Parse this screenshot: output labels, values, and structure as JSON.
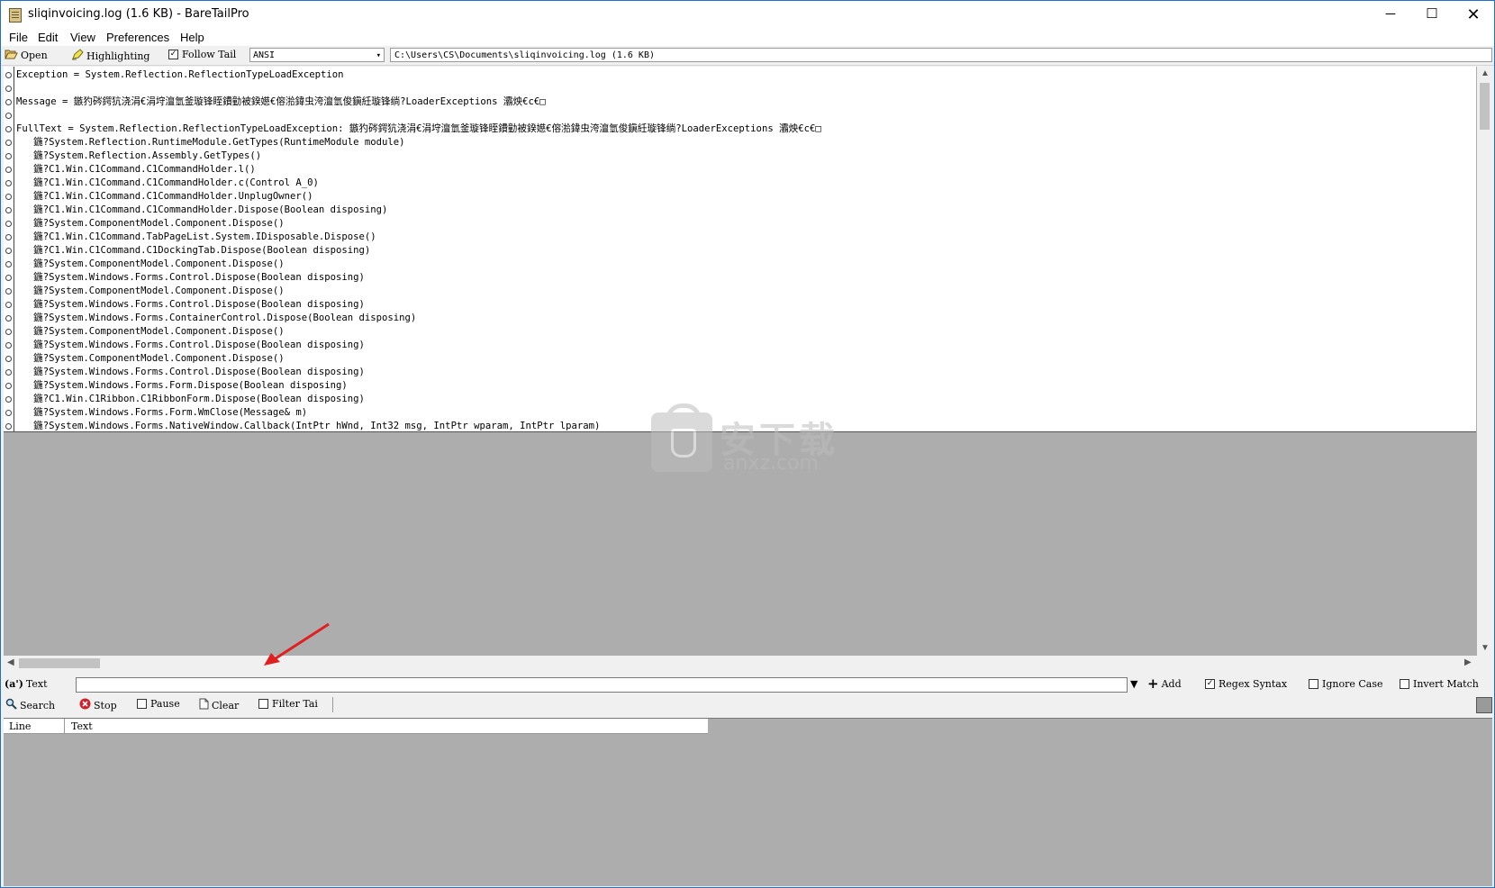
{
  "window": {
    "title": "sliqinvoicing.log (1.6 KB) - BareTailPro",
    "minimize": "─",
    "maximize": "☐",
    "close": "✕"
  },
  "menu": [
    "File",
    "Edit",
    "View",
    "Preferences",
    "Help"
  ],
  "toolbar": {
    "open_label": "Open",
    "highlighting_label": "Highlighting",
    "follow_tail_label": "Follow Tail",
    "follow_tail_checked": true,
    "encoding": "ANSI",
    "file_path": "C:\\Users\\CS\\Documents\\sliqinvoicing.log (1.6 KB)"
  },
  "log_lines": [
    "Exception = System.Reflection.ReflectionTypeLoadException",
    "",
    "Message = 鏃犳硶鍔犺浇涓€涓垨澶氫釜璇锋眰鐨勭被鍨嬨€傛湁鍏虫洿澶氫俊鎭紝璇锋绱?LoaderExceptions 灞炴€с€□",
    "",
    "FullText = System.Reflection.ReflectionTypeLoadException: 鏃犳硶鍔犺浇涓€涓垨澶氫釜璇锋眰鐨勭被鍨嬨€傛湁鍏虫洿澶氫俊鎭紝璇锋绱?LoaderExceptions 灞炴€с€□",
    "   鍦?System.Reflection.RuntimeModule.GetTypes(RuntimeModule module)",
    "   鍦?System.Reflection.Assembly.GetTypes()",
    "   鍦?C1.Win.C1Command.C1CommandHolder.l()",
    "   鍦?C1.Win.C1Command.C1CommandHolder.c(Control A_0)",
    "   鍦?C1.Win.C1Command.C1CommandHolder.UnplugOwner()",
    "   鍦?C1.Win.C1Command.C1CommandHolder.Dispose(Boolean disposing)",
    "   鍦?System.ComponentModel.Component.Dispose()",
    "   鍦?C1.Win.C1Command.TabPageList.System.IDisposable.Dispose()",
    "   鍦?C1.Win.C1Command.C1DockingTab.Dispose(Boolean disposing)",
    "   鍦?System.ComponentModel.Component.Dispose()",
    "   鍦?System.Windows.Forms.Control.Dispose(Boolean disposing)",
    "   鍦?System.ComponentModel.Component.Dispose()",
    "   鍦?System.Windows.Forms.Control.Dispose(Boolean disposing)",
    "   鍦?System.Windows.Forms.ContainerControl.Dispose(Boolean disposing)",
    "   鍦?System.ComponentModel.Component.Dispose()",
    "   鍦?System.Windows.Forms.Control.Dispose(Boolean disposing)",
    "   鍦?System.ComponentModel.Component.Dispose()",
    "   鍦?System.Windows.Forms.Control.Dispose(Boolean disposing)",
    "   鍦?System.Windows.Forms.Form.Dispose(Boolean disposing)",
    "   鍦?C1.Win.C1Ribbon.C1RibbonForm.Dispose(Boolean disposing)",
    "   鍦?System.Windows.Forms.Form.WmClose(Message& m)",
    "   鍦?System.Windows.Forms.NativeWindow.Callback(IntPtr hWnd, Int32 msg, IntPtr wparam, IntPtr lparam)"
  ],
  "watermark": {
    "text": "安下载",
    "sub": "anxz.com"
  },
  "filter": {
    "mode_label": "Text",
    "input_value": "",
    "add_label": "Add",
    "regex_label": "Regex Syntax",
    "regex_checked": true,
    "ignore_case_label": "Ignore Case",
    "ignore_case_checked": false,
    "invert_match_label": "Invert Match",
    "invert_match_checked": false,
    "search_label": "Search",
    "stop_label": "Stop",
    "pause_label": "Pause",
    "pause_checked": false,
    "clear_label": "Clear",
    "filter_tail_label": "Filter Tai",
    "filter_tail_checked": false
  },
  "results": {
    "columns": [
      "Line",
      "Text"
    ]
  },
  "colors": {
    "accent": "#1e6fd1",
    "arrow": "#e02020",
    "stop": "#d0202a"
  }
}
